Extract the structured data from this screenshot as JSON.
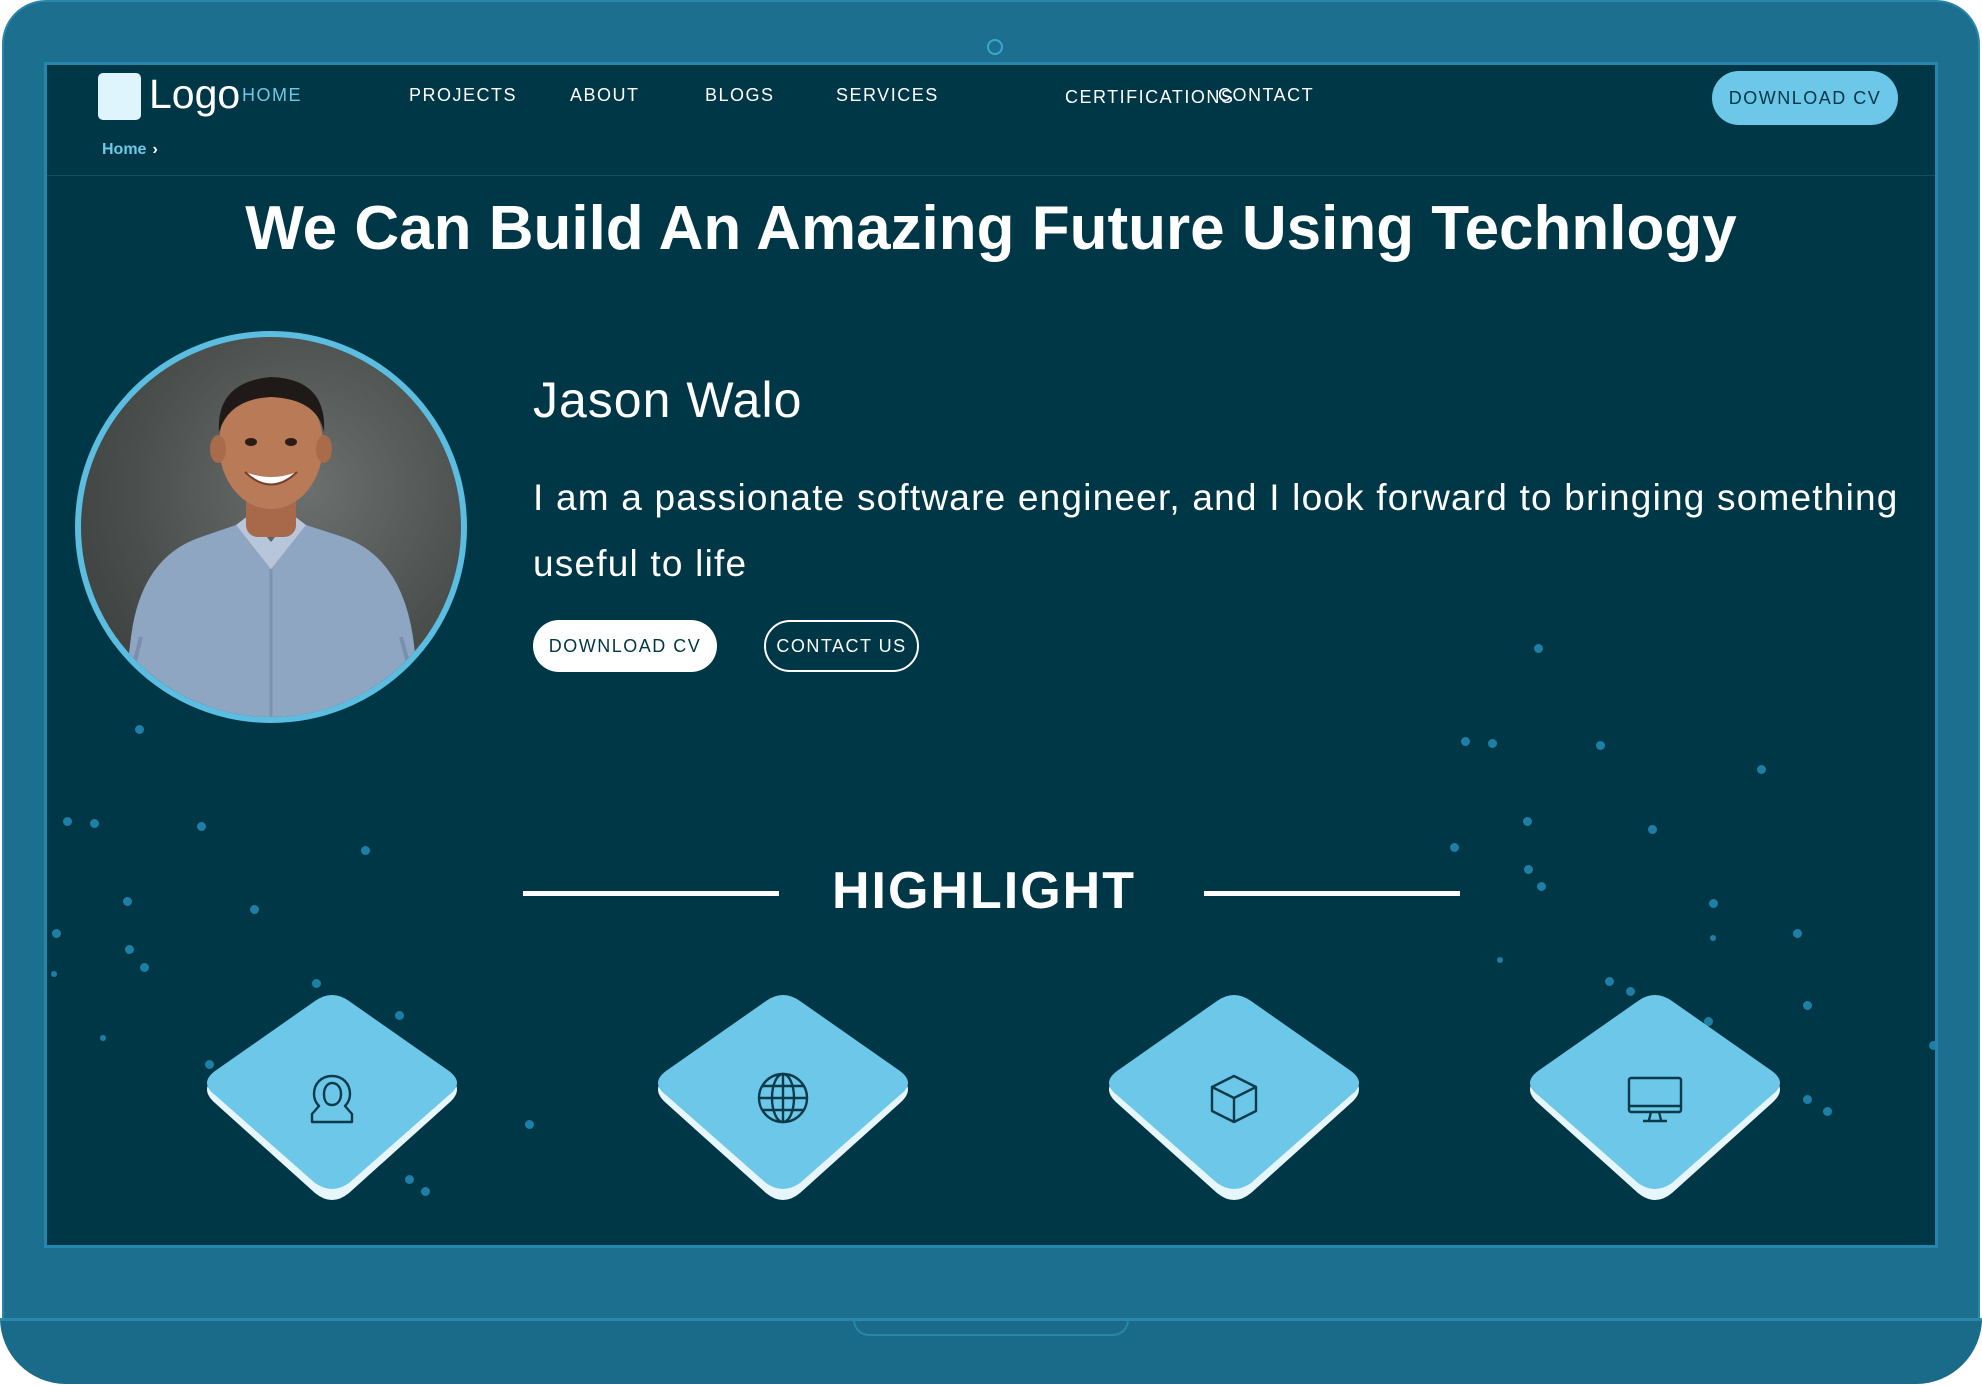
{
  "nav": {
    "logo_text": "Logo",
    "items": [
      {
        "label": "HOME",
        "active": true
      },
      {
        "label": "PROJECTS"
      },
      {
        "label": "ABOUT"
      },
      {
        "label": "BLOGS"
      },
      {
        "label": "SERVICES"
      },
      {
        "label": "CERTIFICATIONS"
      },
      {
        "label": "CONTACT"
      }
    ],
    "cta_label": "DOWNLOAD CV"
  },
  "breadcrumb": {
    "current": "Home"
  },
  "hero": {
    "title": "We Can Build An Amazing Future Using Technlogy",
    "name": "Jason Walo",
    "bio": "I am a passionate software engineer, and I look forward to bringing something useful to life",
    "primary_button": "DOWNLOAD CV",
    "secondary_button": "CONTACT US"
  },
  "highlight": {
    "title": "HIGHLIGHT",
    "tiles": [
      {
        "icon": "user-icon"
      },
      {
        "icon": "globe-icon"
      },
      {
        "icon": "cube-icon"
      },
      {
        "icon": "monitor-icon"
      }
    ]
  },
  "colors": {
    "screen_bg": "#003746",
    "accent": "#6cc7e8",
    "frame": "#1c6f8f",
    "text": "#ffffff"
  }
}
